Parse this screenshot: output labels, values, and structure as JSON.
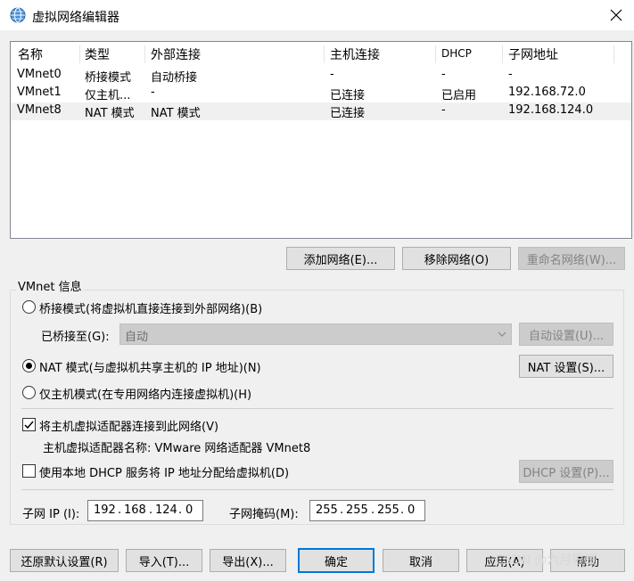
{
  "window": {
    "title": "虚拟网络编辑器"
  },
  "table": {
    "columns": [
      "名称",
      "类型",
      "外部连接",
      "主机连接",
      "DHCP",
      "子网地址"
    ],
    "rows": [
      [
        "VMnet0",
        "桥接模式",
        "自动桥接",
        "-",
        "-",
        "-"
      ],
      [
        "VMnet1",
        "仅主机...",
        "-",
        "已连接",
        "已启用",
        "192.168.72.0"
      ],
      [
        "VMnet8",
        "NAT 模式",
        "NAT 模式",
        "已连接",
        "-",
        "192.168.124.0"
      ]
    ],
    "selected_row": 2
  },
  "network_buttons": {
    "add": "添加网络(E)...",
    "remove": "移除网络(O)",
    "rename": "重命名网络(W)..."
  },
  "vmnet_info": {
    "group_label": "VMnet 信息",
    "bridged_label": "桥接模式(将虚拟机直接连接到外部网络)(B)",
    "bridged_to_label": "已桥接至(G):",
    "bridged_to_value": "自动",
    "auto_settings": "自动设置(U)...",
    "nat_label": "NAT 模式(与虚拟机共享主机的 IP 地址)(N)",
    "nat_settings": "NAT 设置(S)...",
    "host_only_label": "仅主机模式(在专用网络内连接虚拟机)(H)",
    "selected_mode": "nat",
    "connect_adapter_label": "将主机虚拟适配器连接到此网络(V)",
    "connect_adapter_checked": true,
    "adapter_name_label": "主机虚拟适配器名称: VMware 网络适配器 VMnet8",
    "dhcp_label": "使用本地 DHCP 服务将 IP 地址分配给虚拟机(D)",
    "dhcp_checked": false,
    "dhcp_settings": "DHCP 设置(P)...",
    "subnet_ip_label": "子网 IP (I):",
    "subnet_ip": [
      "192",
      "168",
      "124",
      "0"
    ],
    "subnet_mask_label": "子网掩码(M):",
    "subnet_mask": [
      "255",
      "255",
      "255",
      "0"
    ]
  },
  "footer": {
    "restore": "还原默认设置(R)",
    "import": "导入(T)...",
    "export": "导出(X)...",
    "ok": "确定",
    "cancel": "取消",
    "apply": "应用(A)",
    "help": "帮助"
  },
  "watermark": "CSDN @六月很暖"
}
